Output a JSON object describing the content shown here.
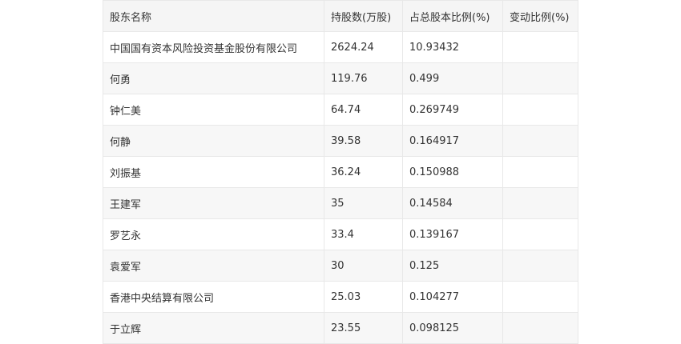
{
  "table": {
    "headers": [
      "股东名称",
      "持股数(万股)",
      "占总股本比例(%)",
      "变动比例(%)"
    ],
    "rows": [
      [
        "中国国有资本风险投资基金股份有限公司",
        "2624.24",
        "10.93432",
        ""
      ],
      [
        "何勇",
        "119.76",
        "0.499",
        ""
      ],
      [
        "钟仁美",
        "64.74",
        "0.269749",
        ""
      ],
      [
        "何静",
        "39.58",
        "0.164917",
        ""
      ],
      [
        "刘振基",
        "36.24",
        "0.150988",
        ""
      ],
      [
        "王建军",
        "35",
        "0.14584",
        ""
      ],
      [
        "罗艺永",
        "33.4",
        "0.139167",
        ""
      ],
      [
        "袁爱军",
        "30",
        "0.125",
        ""
      ],
      [
        "香港中央结算有限公司",
        "25.03",
        "0.104277",
        ""
      ],
      [
        "于立辉",
        "23.55",
        "0.098125",
        ""
      ]
    ]
  }
}
